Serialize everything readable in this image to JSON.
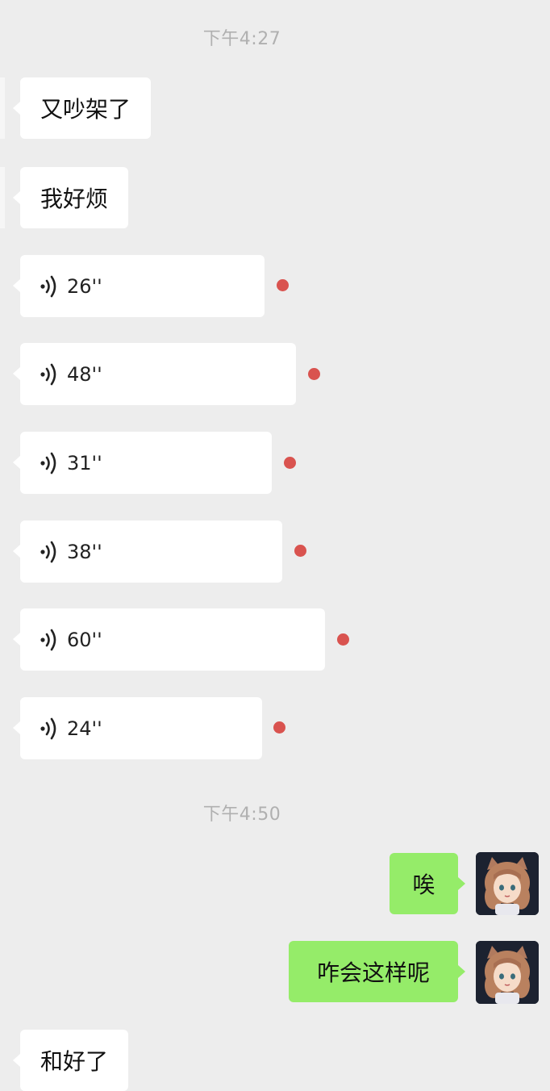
{
  "chat": {
    "timestamps": [
      "下午4:27",
      "下午4:50"
    ],
    "incoming_text_1": "又吵架了",
    "incoming_text_2": "我好烦",
    "voice_messages": [
      {
        "duration": "26''",
        "unread": true
      },
      {
        "duration": "48''",
        "unread": true
      },
      {
        "duration": "31''",
        "unread": true
      },
      {
        "duration": "38''",
        "unread": true
      },
      {
        "duration": "60''",
        "unread": true
      },
      {
        "duration": "24''",
        "unread": true
      }
    ],
    "outgoing_text_1": "唉",
    "outgoing_text_2": "咋会这样呢",
    "incoming_text_3": "和好了"
  },
  "colors": {
    "background": "#ededed",
    "incoming_bubble": "#ffffff",
    "outgoing_bubble": "#95ec69",
    "unread_dot": "#d9534f",
    "timestamp_text": "#b0b0b0"
  },
  "icons": {
    "voice": "voice-wave-icon",
    "avatar": "anime-girl-avatar"
  }
}
